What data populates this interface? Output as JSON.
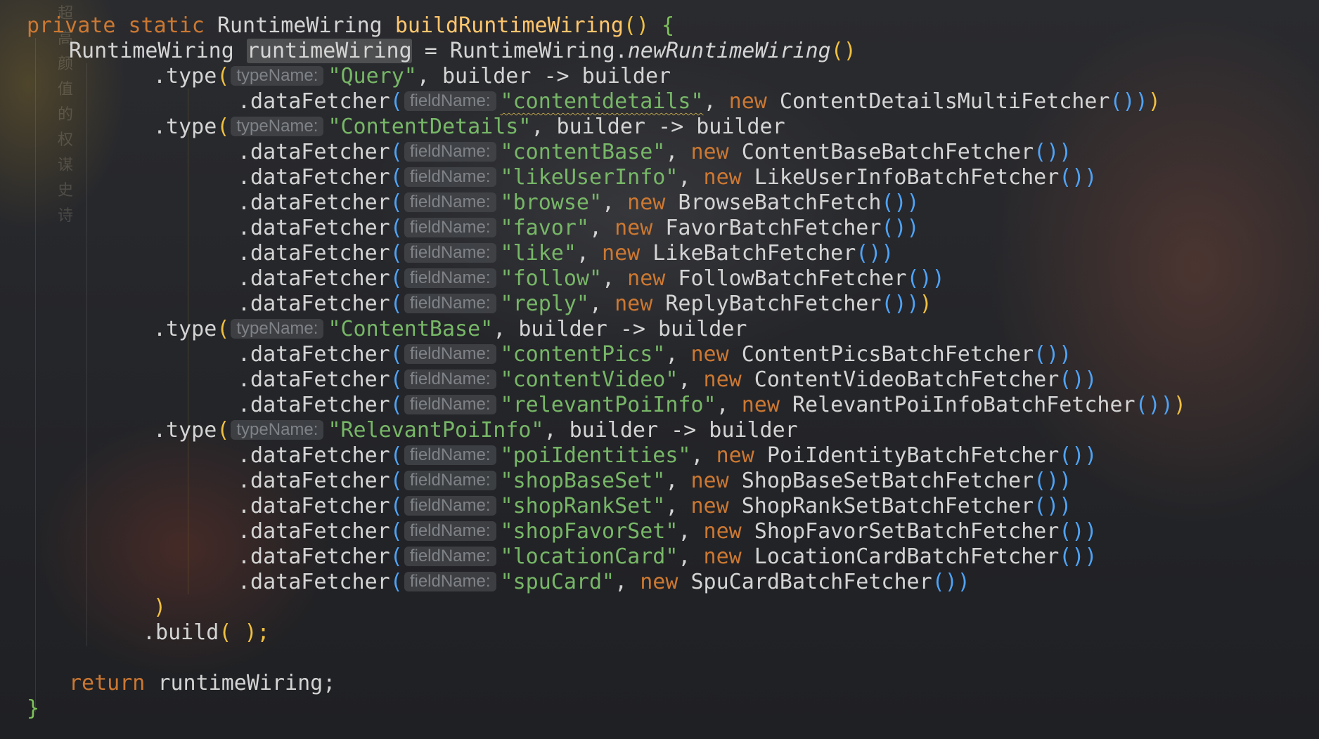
{
  "background": {
    "vertical_caption": "超高颜值的权谋史诗"
  },
  "code": {
    "signature": {
      "kw1": "private",
      "kw2": "static",
      "return_type": "RuntimeWiring",
      "method": "buildRuntimeWiring",
      "parens": "()",
      "open_brace": "{"
    },
    "decl": {
      "type": "RuntimeWiring",
      "var": "runtimeWiring",
      "eq": " = ",
      "cls": "RuntimeWiring.",
      "factory": "newRuntimeWiring",
      "parens": "()"
    },
    "type_hint": "typeName:",
    "field_hint": "fieldName:",
    "type_method": ".type",
    "fetcher_method": ".dataFetcher",
    "new_kw": "new",
    "lambda": "builder -> builder",
    "types": [
      {
        "name": "\"Query\"",
        "fetchers": [
          {
            "field": "\"contentdetails\"",
            "cls": "ContentDetailsMultiFetcher",
            "squiggle": true
          }
        ]
      },
      {
        "name": "\"ContentDetails\"",
        "fetchers": [
          {
            "field": "\"contentBase\"",
            "cls": "ContentBaseBatchFetcher"
          },
          {
            "field": "\"likeUserInfo\"",
            "cls": "LikeUserInfoBatchFetcher"
          },
          {
            "field": "\"browse\"",
            "cls": "BrowseBatchFetch"
          },
          {
            "field": "\"favor\"",
            "cls": "FavorBatchFetcher"
          },
          {
            "field": "\"like\"",
            "cls": "LikeBatchFetcher"
          },
          {
            "field": "\"follow\"",
            "cls": "FollowBatchFetcher"
          },
          {
            "field": "\"reply\"",
            "cls": "ReplyBatchFetcher"
          }
        ]
      },
      {
        "name": "\"ContentBase\"",
        "fetchers": [
          {
            "field": "\"contentPics\"",
            "cls": "ContentPicsBatchFetcher"
          },
          {
            "field": "\"contentVideo\"",
            "cls": "ContentVideoBatchFetcher"
          },
          {
            "field": "\"relevantPoiInfo\"",
            "cls": "RelevantPoiInfoBatchFetcher"
          }
        ]
      },
      {
        "name": "\"RelevantPoiInfo\"",
        "fetchers": [
          {
            "field": "\"poiIdentities\"",
            "cls": "PoiIdentityBatchFetcher"
          },
          {
            "field": "\"shopBaseSet\"",
            "cls": "ShopBaseSetBatchFetcher"
          },
          {
            "field": "\"shopRankSet\"",
            "cls": "ShopRankSetBatchFetcher"
          },
          {
            "field": "\"shopFavorSet\"",
            "cls": "ShopFavorSetBatchFetcher"
          },
          {
            "field": "\"locationCard\"",
            "cls": "LocationCardBatchFetcher"
          },
          {
            "field": "\"spuCard\"",
            "cls": "SpuCardBatchFetcher"
          }
        ]
      }
    ],
    "close_paren": ")",
    "build": ".build",
    "build_args": "( );",
    "return_kw": "return",
    "return_expr": "runtimeWiring;",
    "close_brace": "}"
  },
  "colors": {
    "keyword": "#cc7832",
    "method_decl": "#ffc66d",
    "string": "#77b767",
    "paren_outer": "#f0c040",
    "paren_inner": "#4fa3f7",
    "hint_bg": "#46484c"
  }
}
